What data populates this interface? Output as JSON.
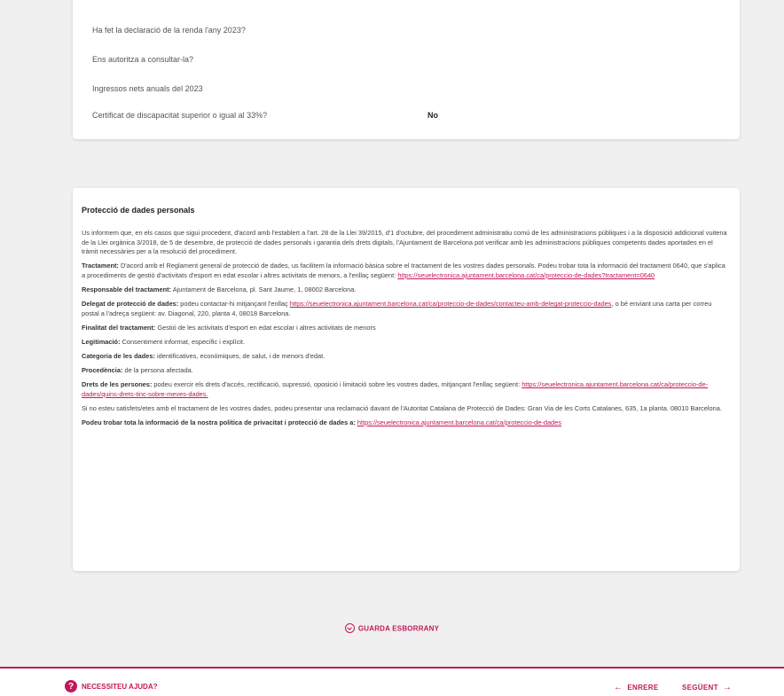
{
  "summary": {
    "rows": [
      {
        "label": "Ha fet la declaració de la renda l'any 2023?",
        "value": ""
      },
      {
        "label": "Ens autoritza a consultar-la?",
        "value": ""
      },
      {
        "label": "Ingressos nets anuals del 2023",
        "value": ""
      },
      {
        "label": "Certificat de discapacitat superior o igual al 33%?",
        "value": "No"
      }
    ]
  },
  "privacy": {
    "title": "Protecció de dades personals",
    "intro": "Us informem que, en els casos que sigui procedent, d'acord amb l'establert a l'art. 28 de la Llei 39/2015, d'1 d'octubre, del procediment administratiu comú de les administracions públiques i a la disposició addicional vuitena de la Llei orgànica 3/2018, de 5 de desembre, de protecció de dades personals i garantia dels drets digitals, l'Ajuntament de Barcelona pot verificar amb les administracions públiques competents dades aportades en el tràmit necessàries per a la resolució del procediment.",
    "treatment_label": "Tractament:",
    "treatment_text": " D'acord amb el Reglament general de protecció de dades, us facilitem la informació bàsica sobre el tractament de les vostres dades personals. Podeu trobar tota la informació del tractament 0640, que s'aplica a procediments de gestió d'activitats d'esport en edat escolar i altres activitats de menors, a l'enllaç següent: ",
    "treatment_link": "https://seuelectronica.ajuntament.barcelona.cat/ca/proteccio-de-dades?tractament=0640",
    "responsible_label": "Responsable del tractament:",
    "responsible_text": " Ajuntament de Barcelona, pl. Sant Jaume, 1, 08002 Barcelona.",
    "delegate_label": "Delegat de protecció de dades:",
    "delegate_text": " podeu contactar-hi mitjançant l'enllaç ",
    "delegate_link": "https://seuelectronica.ajuntament.barcelona.cat/ca/proteccio-de-dades/contacteu-amb-delegat-proteccio-dades",
    "delegate_text2": ", o bé enviant una carta per correu postal a l'adreça següent: av. Diagonal, 220, planta 4, 08018 Barcelona.",
    "purpose_label": "Finalitat del tractament:",
    "purpose_text": " Gestió de les activitats d'esport en edat escolar i altres activitats de menors",
    "legit_label": "Legitimació:",
    "legit_text": " Consentiment informat, específic i explícit.",
    "category_label": "Categoria de les dades:",
    "category_text": " identificatives, econòmiques, de salut, i de menors d'edat.",
    "origin_label": "Procedència:",
    "origin_text": " de la persona afectada.",
    "rights_label": "Drets de les persones:",
    "rights_text": " podeu exercir els drets d'accés, rectificació, supressió, oposició i limitació sobre les vostres dades, mitjançant l'enllaç següent: ",
    "rights_link": "https://seuelectronica.ajuntament.barcelona.cat/ca/proteccio-de-dades/quins-drets-tinc-sobre-meves-dades.",
    "claim_text": "Si no esteu satisfets/etes amb el tractament de les vostres dades, podeu presentar una reclamació davant de l'Autoritat Catalana de Protecció de Dades: Gran Via de les Corts Catalanes, 635, 1a planta. 08010 Barcelona.",
    "policy_label": "Podeu trobar tota la informació de la nostra política de privacitat i protecció de dades a:",
    "policy_link": "https://seuelectronica.ajuntament.barcelona.cat/ca/proteccio-de-dades"
  },
  "actions": {
    "save_draft": "GUARDA ESBORRANY"
  },
  "footer": {
    "help": "NECESSITEU AJUDA?",
    "help_icon": "?",
    "back": "ENRERE",
    "next": "SEGÜENT",
    "accent": "#c2185b"
  }
}
